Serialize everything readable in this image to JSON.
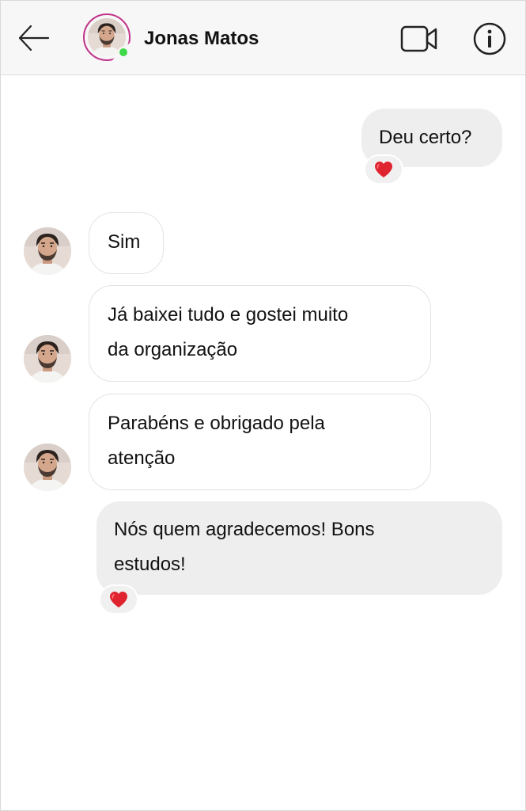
{
  "header": {
    "contact_name": "Jonas Matos",
    "back_icon": "arrow-left-icon",
    "video_icon": "video-camera-icon",
    "info_icon": "info-icon",
    "online_status_color": "#3dd94a",
    "story_ring_color": "#c1338a"
  },
  "messages": [
    {
      "direction": "outgoing",
      "text": "Deu certo?",
      "reaction": "heart"
    },
    {
      "direction": "incoming",
      "text": "Sim"
    },
    {
      "direction": "incoming",
      "line1": "Já baixei tudo e gostei muito",
      "line2": "da organização"
    },
    {
      "direction": "incoming",
      "line1": "Parabéns e obrigado pela",
      "line2": "atenção"
    },
    {
      "direction": "outgoing",
      "line1": "Nós quem agradecemos! Bons",
      "line2": "estudos!",
      "reaction": "heart"
    }
  ],
  "colors": {
    "outgoing_bubble": "#eeeeee",
    "incoming_bubble_border": "#e3e3e3",
    "heart": "#e0242f"
  }
}
